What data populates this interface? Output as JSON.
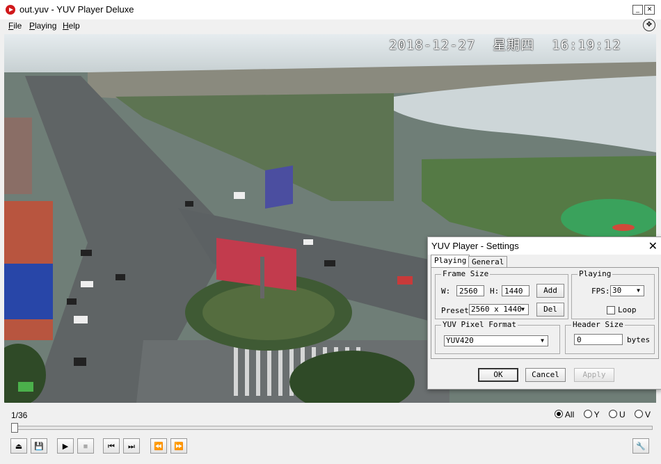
{
  "window": {
    "title": "out.yuv - YUV Player Deluxe"
  },
  "menu": [
    {
      "label": "File",
      "underline": "F",
      "rest": "ile"
    },
    {
      "label": "Playing",
      "underline": "P",
      "rest": "laying"
    },
    {
      "label": "Help",
      "underline": "H",
      "rest": "elp"
    }
  ],
  "video": {
    "osd_timestamp": "2018-12-27  星期四  16:19:12"
  },
  "controls": {
    "frame_counter": "1/36",
    "channels": [
      {
        "label": "All",
        "selected": true
      },
      {
        "label": "Y",
        "selected": false
      },
      {
        "label": "U",
        "selected": false
      },
      {
        "label": "V",
        "selected": false
      }
    ],
    "progress": 0.0
  },
  "dialog": {
    "title": "YUV Player - Settings",
    "tabs": [
      "Playing",
      "General"
    ],
    "active_tab": "Playing",
    "frame_size": {
      "legend": "Frame Size",
      "w_label": "W:",
      "w_value": "2560",
      "h_label": "H:",
      "h_value": "1440",
      "add_label": "Add",
      "preset_label": "Preset",
      "preset_value": "2560 x 1440",
      "del_label": "Del"
    },
    "playing": {
      "legend": "Playing",
      "fps_label": "FPS:",
      "fps_value": "30",
      "loop_label": "Loop",
      "loop_checked": false
    },
    "pixel_format": {
      "legend": "YUV Pixel Format",
      "value": "YUV420"
    },
    "header_size": {
      "legend": "Header Size",
      "value": "0",
      "unit": "bytes"
    },
    "buttons": {
      "ok": "OK",
      "cancel": "Cancel",
      "apply": "Apply"
    }
  },
  "colors": {
    "accent_red": "#d0191b",
    "dialog_bg": "#f0f0f0",
    "selection_blue": "#0078d7"
  }
}
